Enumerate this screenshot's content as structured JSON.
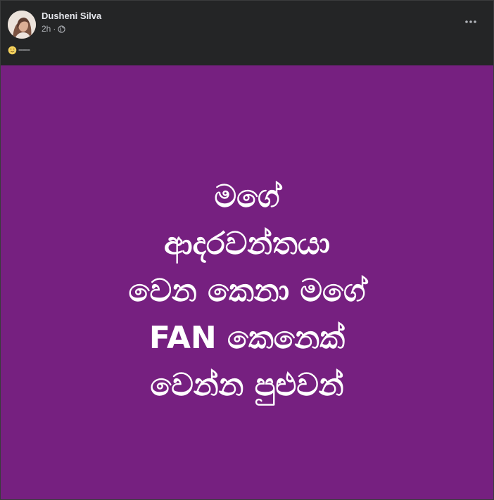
{
  "post": {
    "author": "Dusheni Silva",
    "time": "2h",
    "separator": "·",
    "caption_emoji": "smiling-face-with-tear-icon",
    "caption_text": "------",
    "privacy_icon": "globe-icon",
    "more_icon": "more-options-icon"
  },
  "image": {
    "background_color": "#762080",
    "text_color": "#ffffff",
    "lines": [
      "මගේ",
      "ආදරවන්තයා",
      "වෙන කෙනා මගේ",
      "FAN කෙනෙක්",
      "වෙන්න පුළුවන්"
    ]
  },
  "colors": {
    "header_bg": "#242526",
    "name_color": "#e4e6eb",
    "meta_color": "#b0b3b8"
  }
}
